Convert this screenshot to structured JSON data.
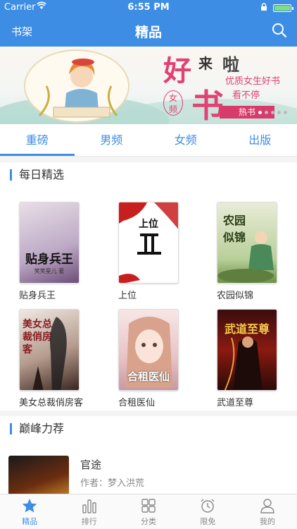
{
  "status": {
    "carrier": "Carrier",
    "time": "6:55 PM",
    "battery_level": 0.9
  },
  "navbar": {
    "left": "书架",
    "title": "精品",
    "search_icon": "search-icon"
  },
  "banner": {
    "big1": "好",
    "big2": "书",
    "small1": "来",
    "small2": "啦",
    "tag1": "优质女生好书",
    "tag2": "看不停",
    "circle_top": "女",
    "circle_bottom": "频",
    "hot": "热书",
    "accent": "#e04373"
  },
  "tabs": [
    {
      "label": "重磅",
      "active": true
    },
    {
      "label": "男频",
      "active": false
    },
    {
      "label": "女频",
      "active": false
    },
    {
      "label": "出版",
      "active": false
    }
  ],
  "daily": {
    "title": "每日精选",
    "books": [
      {
        "name": "贴身兵王",
        "cover_text": "贴身兵王",
        "cover_sub": "笑笑星儿 著"
      },
      {
        "name": "上位",
        "cover_text": "上位",
        "cover_sub": ""
      },
      {
        "name": "农园似锦",
        "cover_text": "农园似锦",
        "cover_sub": ""
      },
      {
        "name": "美女总裁俏房客",
        "cover_text": "美女总裁俏房客",
        "cover_sub": ""
      },
      {
        "name": "合租医仙",
        "cover_text": "合租医仙",
        "cover_sub": ""
      },
      {
        "name": "武道至尊",
        "cover_text": "武道至尊",
        "cover_sub": ""
      }
    ]
  },
  "peak": {
    "title": "巅峰力荐",
    "item": {
      "title": "官途",
      "author": "作者：梦入洪荒"
    }
  },
  "tabbar": [
    {
      "label": "精品",
      "icon": "star-icon",
      "active": true
    },
    {
      "label": "排行",
      "icon": "bar-chart-icon",
      "active": false
    },
    {
      "label": "分类",
      "icon": "grid-icon",
      "active": false
    },
    {
      "label": "限免",
      "icon": "alarm-clock-icon",
      "active": false
    },
    {
      "label": "我的",
      "icon": "person-icon",
      "active": false
    }
  ],
  "colors": {
    "primary": "#3d8de4"
  }
}
